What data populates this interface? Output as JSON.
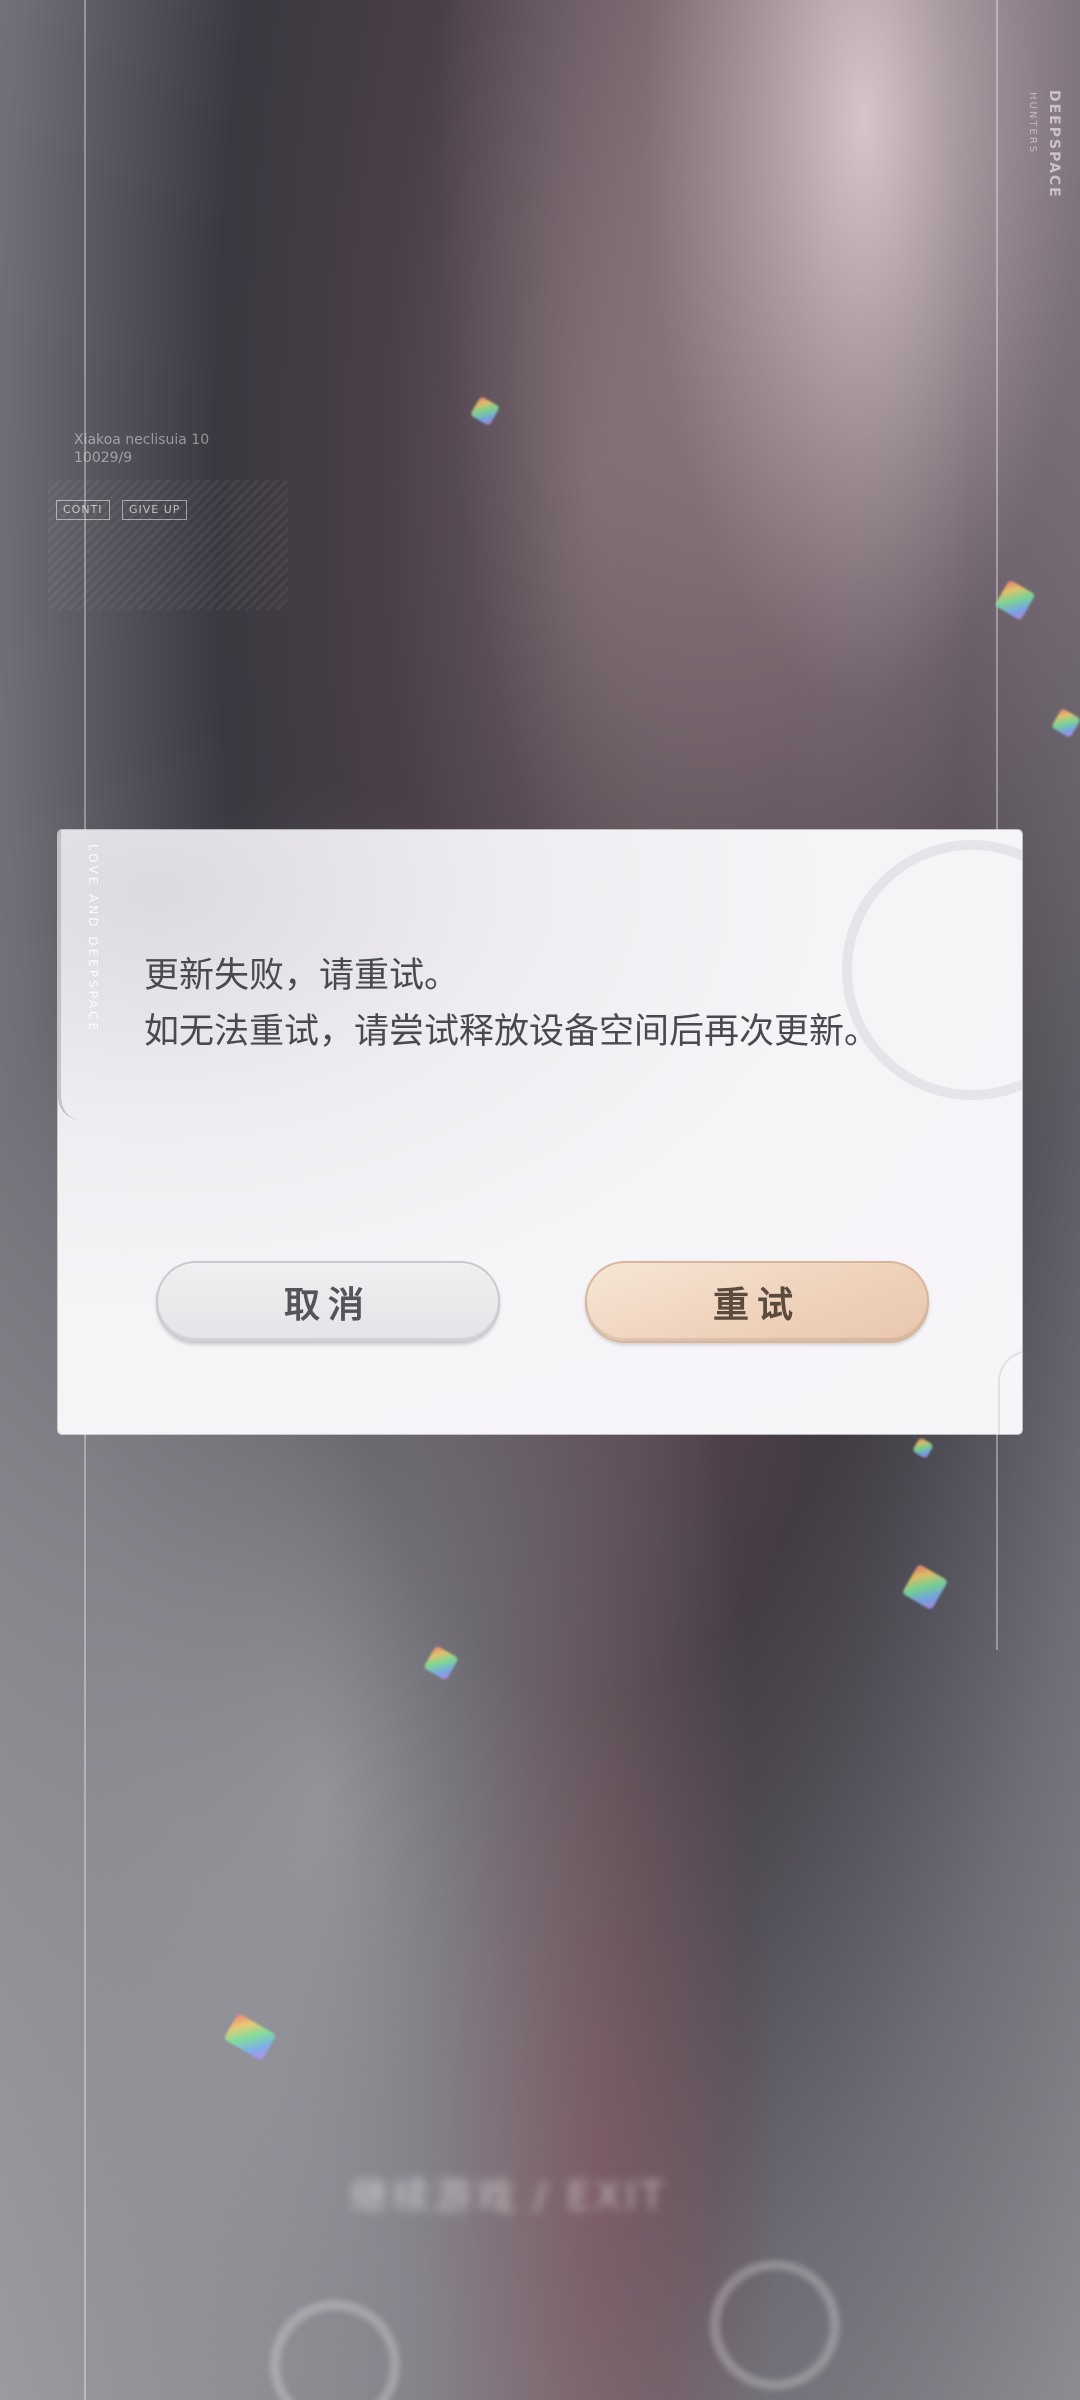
{
  "background": {
    "brand_vertical": "DEEPSPACE",
    "brand_vertical_small": "HUNTERS",
    "hud_name": "Xiakoa neclisuia 10",
    "hud_id": "10029/9",
    "hud_btn_1": "CONTI",
    "hud_btn_2": "GIVE UP",
    "bottom_text": "继续游戏 / EXIT"
  },
  "dialog": {
    "deco_vertical_text": "LOVE AND DEEPSPACE",
    "message_line_1": "更新失败，请重试。",
    "message_line_2": "如无法重试，请尝试释放设备空间后再次更新。",
    "cancel_label": "取消",
    "retry_label": "重试"
  },
  "colors": {
    "retry_button": "#efd3bc",
    "cancel_button": "#e8e8ec",
    "message_text": "#4a4950"
  }
}
